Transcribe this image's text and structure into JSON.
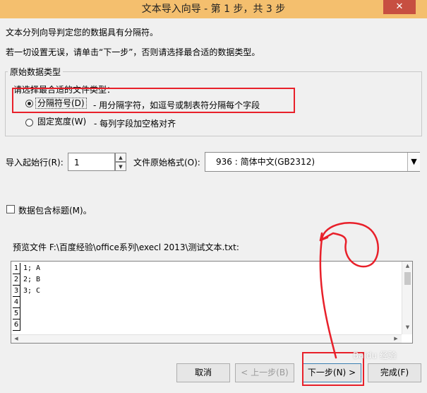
{
  "window": {
    "title": "文本导入向导 - 第 1 步，共 3 步",
    "close_glyph": "✕"
  },
  "intro": {
    "line1": "文本分列向导判定您的数据具有分隔符。",
    "line2": "若一切设置无误，请单击“下一步”，否则请选择最合适的数据类型。"
  },
  "original_type": {
    "group_label": "原始数据类型",
    "prompt": "请选择最合适的文件类型：",
    "options": [
      {
        "label": "分隔符号(D)",
        "desc": "- 用分隔字符，如逗号或制表符分隔每个字段",
        "selected": true
      },
      {
        "label": "固定宽度(W)",
        "desc": "- 每列字段加空格对齐",
        "selected": false
      }
    ]
  },
  "start_row": {
    "label": "导入起始行(R):",
    "value": "1"
  },
  "file_origin": {
    "label": "文件原始格式(O):",
    "value": "936 : 简体中文(GB2312)"
  },
  "headers_checkbox": {
    "label": "数据包含标题(M)。",
    "checked": false
  },
  "preview": {
    "label": "预览文件 F:\\百度经验\\office系列\\execl 2013\\测试文本.txt:",
    "row_numbers": [
      "1",
      "2",
      "3",
      "4",
      "5",
      "6"
    ],
    "rows": [
      "1; A",
      "2; B",
      "3; C",
      "",
      "",
      ""
    ]
  },
  "buttons": {
    "cancel": "取消",
    "back": "< 上一步(B)",
    "next": "下一步(N) >",
    "finish": "完成(F)"
  },
  "watermark": "Baidu 经验",
  "colors": {
    "titlebar": "#f4bf6e",
    "annotation": "#e8202a"
  }
}
